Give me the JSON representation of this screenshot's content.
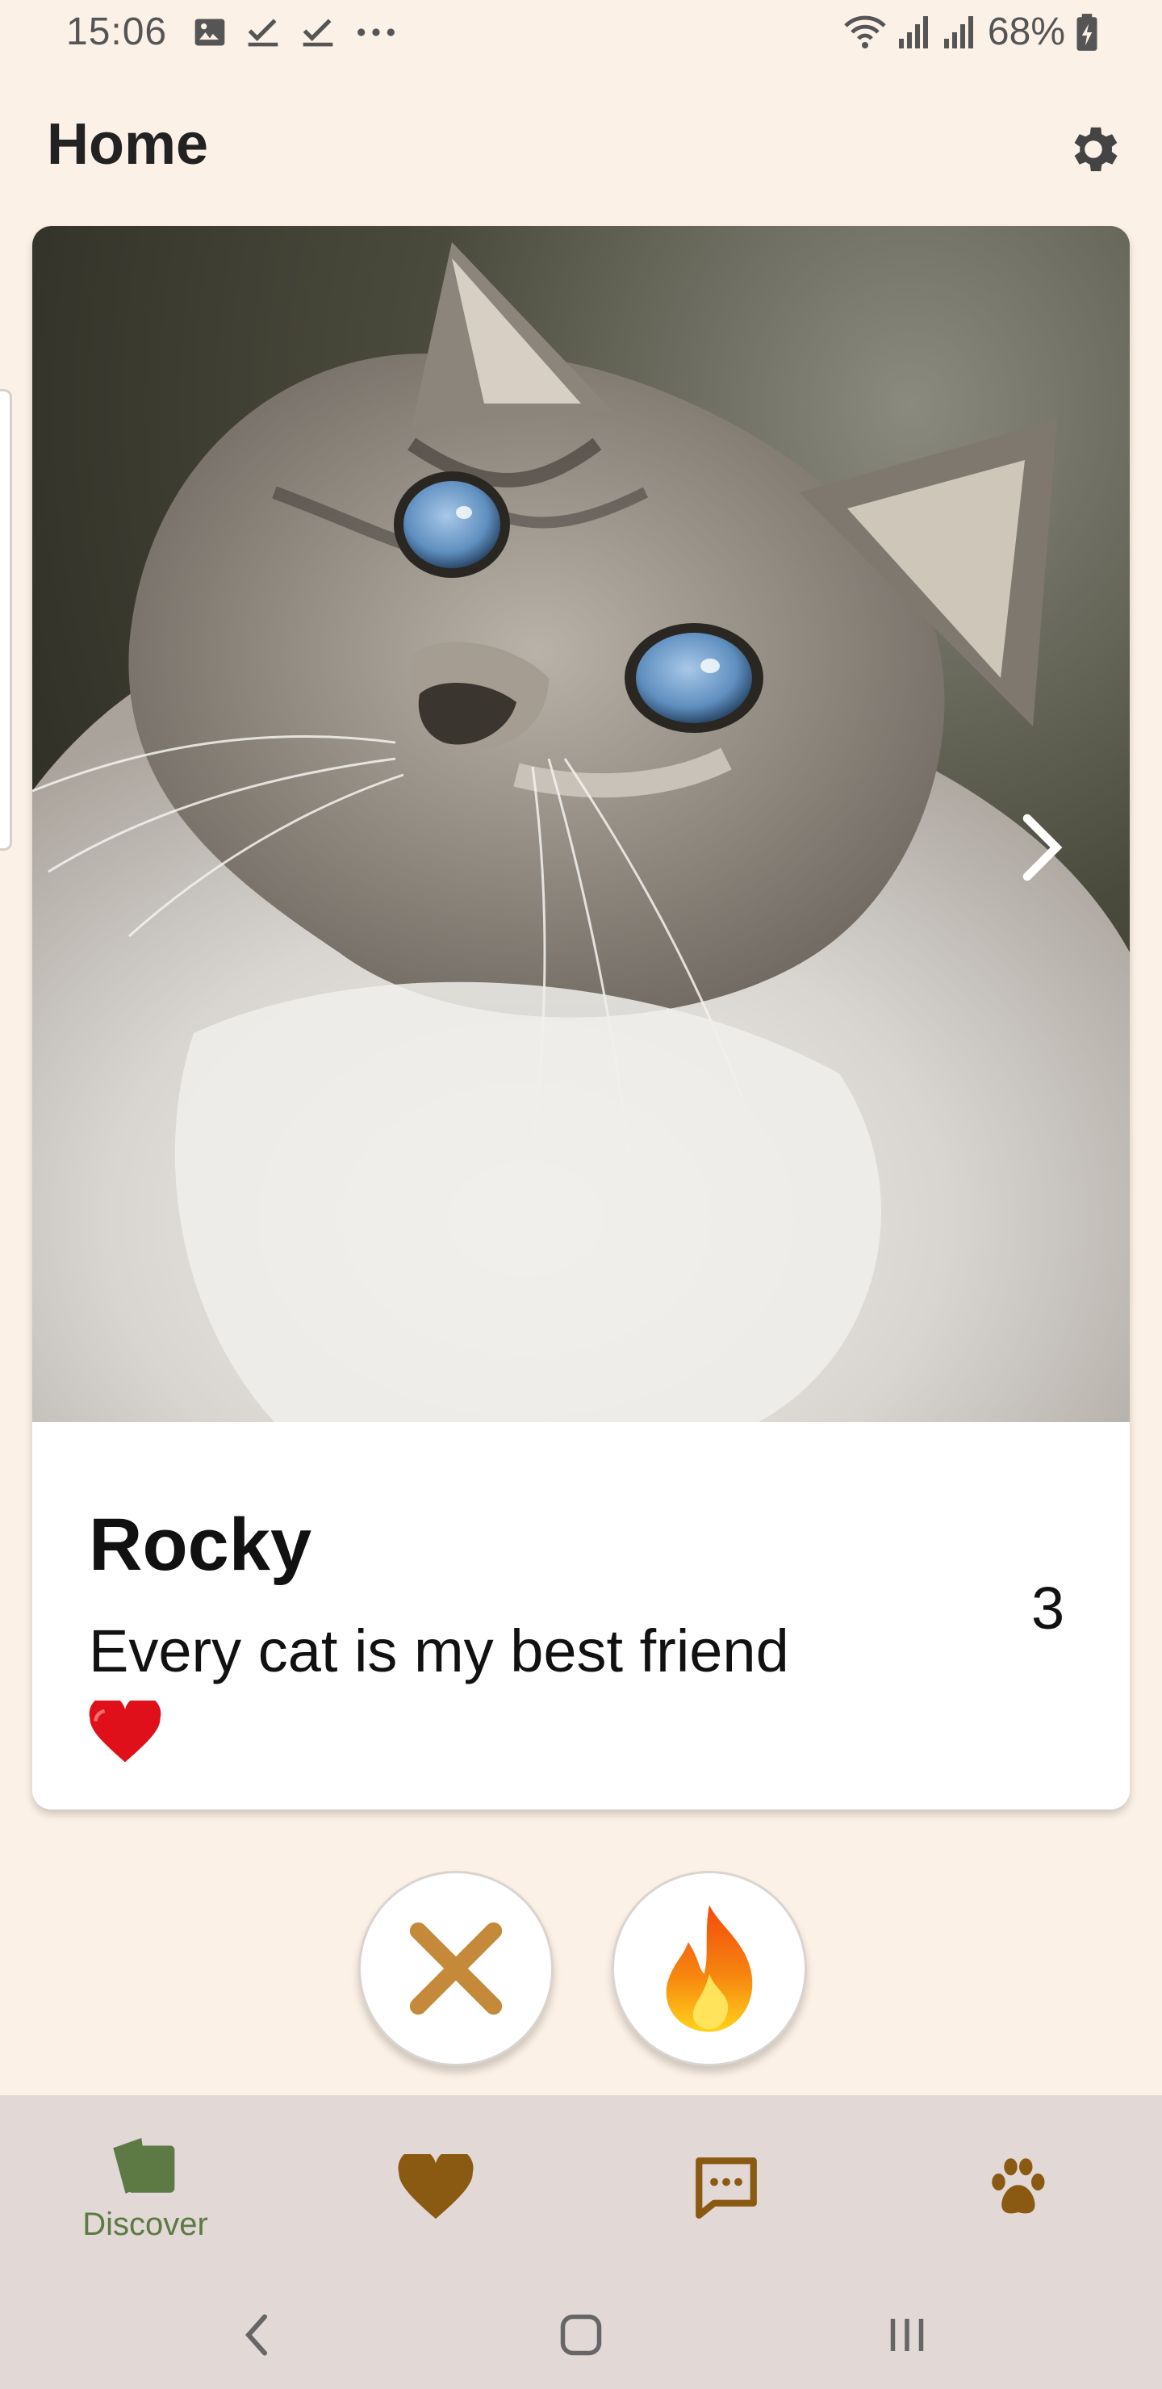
{
  "status_bar": {
    "time": "15:06",
    "left_icons": [
      "image-icon",
      "check-icon",
      "check-icon",
      "more-dots-icon"
    ],
    "right_icons": [
      "wifi-icon",
      "signal-icon",
      "signal-icon"
    ],
    "battery_percent": "68%"
  },
  "header": {
    "title": "Home",
    "settings_icon": "gear-icon"
  },
  "card": {
    "photo_icon": "cat-photo",
    "name": "Rocky",
    "bio": "Every cat is my best friend",
    "bio_emoji": "red-heart",
    "count": "3"
  },
  "actions": {
    "dislike_icon": "cross-icon",
    "like_icon": "fire-icon"
  },
  "bottom_nav": {
    "items": [
      {
        "label": "Discover",
        "icon": "cards-icon",
        "active": true
      },
      {
        "label": "",
        "icon": "heart-icon",
        "active": false
      },
      {
        "label": "",
        "icon": "chat-icon",
        "active": false
      },
      {
        "label": "",
        "icon": "paw-icon",
        "active": false
      }
    ]
  },
  "colors": {
    "background": "#fcf1e6",
    "nav_background": "#e2d8d6",
    "active_nav": "#5d7a44",
    "inactive_nav": "#8a5a12",
    "cross": "#c48a3a"
  }
}
